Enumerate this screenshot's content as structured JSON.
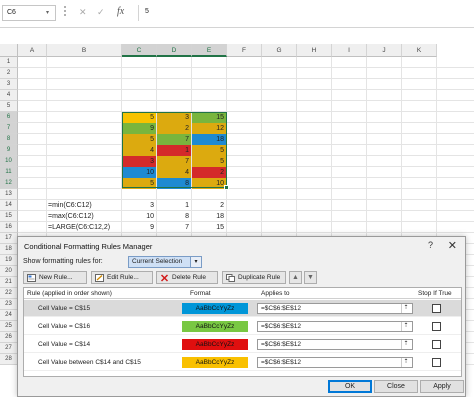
{
  "formula_bar": {
    "name_box": "C6",
    "cancel_glyph": "✕",
    "enter_glyph": "✓",
    "fx_label": "fx",
    "content": "5"
  },
  "columns": [
    "A",
    "B",
    "C",
    "D",
    "E",
    "F",
    "G",
    "H",
    "I",
    "J",
    "K"
  ],
  "selected_columns": [
    "C",
    "D",
    "E"
  ],
  "rows": [
    "1",
    "2",
    "3",
    "4",
    "5",
    "6",
    "7",
    "8",
    "9",
    "10",
    "11",
    "12",
    "13",
    "14",
    "15",
    "16",
    "17",
    "18",
    "19",
    "20",
    "21",
    "22",
    "23",
    "24",
    "25",
    "26",
    "27",
    "28"
  ],
  "selected_rows": [
    "6",
    "7",
    "8",
    "9",
    "10",
    "11",
    "12"
  ],
  "colors": {
    "gold": "#dcaa0f",
    "green": "#79b53d",
    "blue": "#1e8ad2",
    "red": "#d42a2a",
    "orange": "#f7c200",
    "excel_green": "#217346"
  },
  "data_cells": [
    {
      "row": "6",
      "values": [
        {
          "v": "5",
          "c": "orange"
        },
        {
          "v": "3",
          "c": "gold"
        },
        {
          "v": "15",
          "c": "green"
        }
      ]
    },
    {
      "row": "7",
      "values": [
        {
          "v": "9",
          "c": "green"
        },
        {
          "v": "2",
          "c": "gold"
        },
        {
          "v": "12",
          "c": "gold"
        }
      ]
    },
    {
      "row": "8",
      "values": [
        {
          "v": "5",
          "c": "gold"
        },
        {
          "v": "7",
          "c": "green"
        },
        {
          "v": "18",
          "c": "blue"
        }
      ]
    },
    {
      "row": "9",
      "values": [
        {
          "v": "4",
          "c": "gold"
        },
        {
          "v": "1",
          "c": "red"
        },
        {
          "v": "5",
          "c": "gold"
        }
      ]
    },
    {
      "row": "10",
      "values": [
        {
          "v": "3",
          "c": "red"
        },
        {
          "v": "7",
          "c": "gold"
        },
        {
          "v": "5",
          "c": "gold"
        }
      ]
    },
    {
      "row": "11",
      "values": [
        {
          "v": "10",
          "c": "blue"
        },
        {
          "v": "4",
          "c": "gold"
        },
        {
          "v": "2",
          "c": "red"
        }
      ]
    },
    {
      "row": "12",
      "values": [
        {
          "v": "5",
          "c": "gold"
        },
        {
          "v": "8",
          "c": "blue"
        },
        {
          "v": "10",
          "c": "gold"
        }
      ]
    }
  ],
  "formula_rows": [
    {
      "row": "14",
      "label": "=min(C6:C12)",
      "values": [
        "3",
        "1",
        "2"
      ]
    },
    {
      "row": "15",
      "label": "=max(C6:C12)",
      "values": [
        "10",
        "8",
        "18"
      ]
    },
    {
      "row": "16",
      "label": "=LARGE(C6:C12,2)",
      "values": [
        "9",
        "7",
        "15"
      ]
    }
  ],
  "dialog": {
    "title": "Conditional Formatting Rules Manager",
    "help_glyph": "?",
    "close_glyph": "✕",
    "show_label": "Show formatting rules for:",
    "show_value": "Current Selection",
    "buttons": {
      "new_rule": "New Rule...",
      "edit_rule": "Edit Rule...",
      "delete_rule": "Delete Rule",
      "duplicate_rule": "Duplicate Rule"
    },
    "move_up_glyph": "▲",
    "move_down_glyph": "▼",
    "headers": {
      "rule": "Rule (applied in order shown)",
      "format": "Format",
      "applies": "Applies to",
      "stop": "Stop If True"
    },
    "rules": [
      {
        "label": "Cell Value = C$15",
        "preview": "AaBbCcYyZz",
        "bg": "#0096d8",
        "fg": "#111111",
        "applies": "=$C$6:$E$12"
      },
      {
        "label": "Cell Value = C$16",
        "preview": "AaBbCcYyZz",
        "bg": "#79c843",
        "fg": "#111111",
        "applies": "=$C$6:$E$12"
      },
      {
        "label": "Cell Value = C$14",
        "preview": "AaBbCcYyZz",
        "bg": "#e00f0f",
        "fg": "#111111",
        "applies": "=$C$6:$E$12"
      },
      {
        "label": "Cell Value between C$14 and C$15",
        "preview": "AaBbCcYyZz",
        "bg": "#f9c000",
        "fg": "#111111",
        "applies": "=$C$6:$E$12"
      }
    ],
    "ok": "OK",
    "close": "Close",
    "apply": "Apply"
  }
}
